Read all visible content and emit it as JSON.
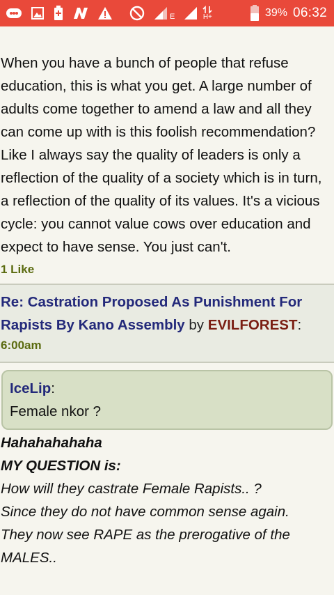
{
  "status_bar": {
    "battery_percent": "39%",
    "time": "06:32",
    "network_label": "H+",
    "small_e": "E",
    "icons": [
      "bbm-icon",
      "image-icon",
      "battery-saver-icon",
      "n-icon",
      "warning-icon",
      "block-icon",
      "signal-icon",
      "signal-icon-2",
      "data-arrows-icon",
      "battery-icon"
    ],
    "bar_color": "#e9493a"
  },
  "previous_post": {
    "text": "When you have a bunch of people that refuse education, this is what you get. A large number of adults come together to amend a law and all they can come up with is this foolish recommendation? Like I always say the quality of leaders is only a reflection of the quality of a society which is in turn, a reflection of the quality of its values. It's a vicious cycle: you cannot value cows over education and expect to have sense. You just can't.",
    "likes": "1 Like"
  },
  "post": {
    "topic_link": "Re: Castration Proposed As Punishment For Rapists By Kano Assembly",
    "by_label": "by",
    "author": "EVILFOREST",
    "author_suffix": ":",
    "time": "6:00am",
    "quote": {
      "author": "IceLip",
      "author_suffix": ":",
      "text": "Female nkor ?"
    },
    "reply_lines": {
      "line1": "Hahahahahaha",
      "line2": "MY QUESTION is:",
      "line3": "How will they castrate Female Rapists.. ?",
      "line4": "Since they do not have common sense again.",
      "line5": "They now see RAPE as the prerogative of the MALES.."
    }
  },
  "colors": {
    "background": "#f6f5ee",
    "link": "#23297a",
    "author": "#7a1e13",
    "likes": "#5b6b10"
  }
}
